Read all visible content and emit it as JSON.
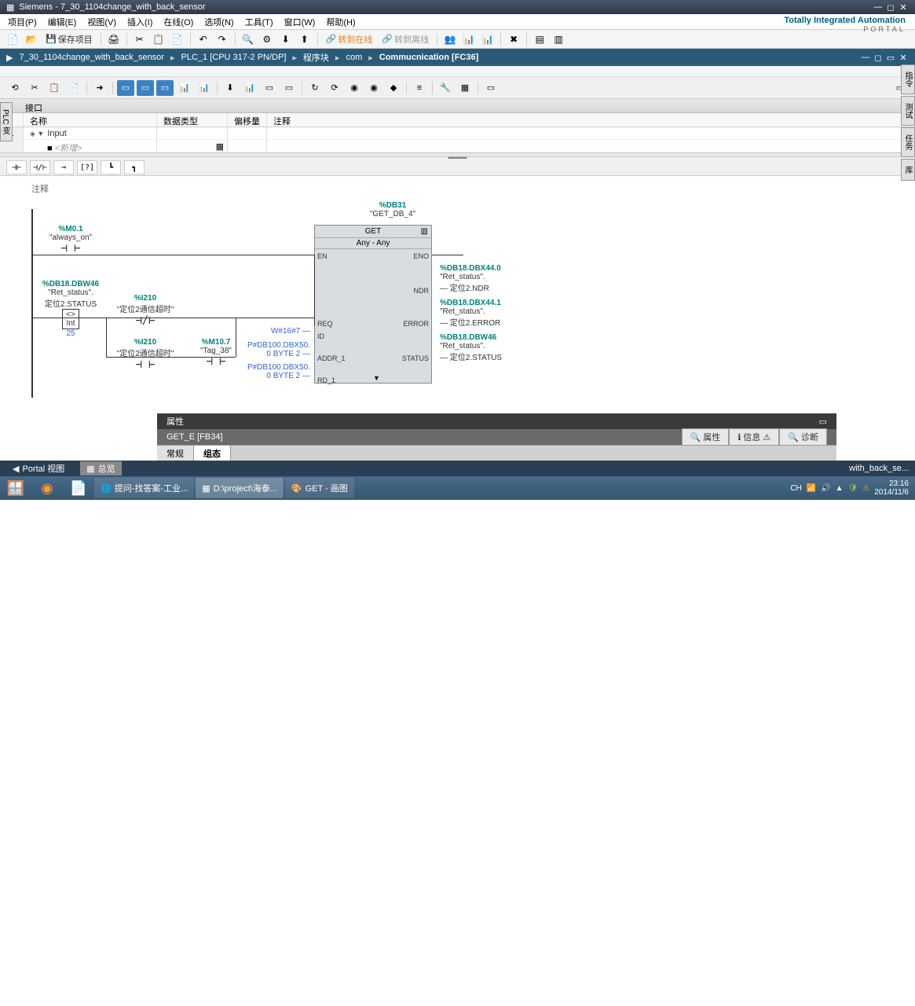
{
  "window": {
    "title": "Siemens - 7_30_1104change_with_back_sensor"
  },
  "brand": {
    "line1": "Totally Integrated Automation",
    "line2": "PORTAL"
  },
  "menu": [
    "项目(P)",
    "编辑(E)",
    "视图(V)",
    "插入(I)",
    "在线(O)",
    "选项(N)",
    "工具(T)",
    "窗口(W)",
    "帮助(H)"
  ],
  "toolbar": {
    "save": "保存项目",
    "go_online": "转到在线",
    "go_offline": "转到离线"
  },
  "breadcrumb": [
    "7_30_1104change_with_back_sensor",
    "PLC_1 [CPU 317-2 PN/DP]",
    "程序块",
    "com",
    "Commucnication [FC36]"
  ],
  "interface": {
    "title": "接口",
    "cols": [
      "",
      "名称",
      "数据类型",
      "偏移量",
      "注释"
    ],
    "rows": [
      {
        "num": "1",
        "name": "Input",
        "indent": 0,
        "expand": true
      },
      {
        "num": "",
        "name": "<新增>",
        "indent": 1,
        "placeholder": true
      }
    ]
  },
  "network": {
    "comment": "注释",
    "db_instance": {
      "addr": "%DB31",
      "name": "\"GET_DB_4\""
    },
    "contact1": {
      "addr": "%M0.1",
      "name": "\"always_on\""
    },
    "contact2": {
      "addr": "%DB18.DBW46",
      "name1": "\"Ret_status\".",
      "name2": "定位2.STATUS",
      "cmp": "<>",
      "type": "Int",
      "val": "25"
    },
    "contact3": {
      "addr": "%I210",
      "name": "\"定位2通信超时\""
    },
    "contact4": {
      "addr": "%I210",
      "name": "\"定位2通信超时\""
    },
    "contact5": {
      "addr": "%M10.7",
      "name": "\"Tag_38\""
    },
    "block": {
      "title": "GET",
      "subtitle": "Any - Any",
      "pins_left": [
        "EN",
        "REQ",
        "ID",
        "ADDR_1",
        "RD_1"
      ],
      "pins_right": [
        "ENO",
        "NDR",
        "ERROR",
        "STATUS"
      ],
      "inputs": {
        "id": "W#16#7",
        "addr1_1": "P#DB100.DBX50.",
        "addr1_2": "0 BYTE 2",
        "rd1_1": "P#DB100.DBX50.",
        "rd1_2": "0 BYTE 2"
      },
      "outputs": {
        "ndr": {
          "addr": "%DB18.DBX44.0",
          "name1": "\"Ret_status\".",
          "name2": "定位2.NDR"
        },
        "error": {
          "addr": "%DB18.DBX44.1",
          "name1": "\"Ret_status\".",
          "name2": "定位2.ERROR"
        },
        "status": {
          "addr": "%DB18.DBW46",
          "name1": "\"Ret_status\".",
          "name2": "定位2.STATUS"
        }
      }
    }
  },
  "properties": {
    "title": "属性",
    "subtitle": "GET_E [FB34]",
    "tabs": [
      "属性",
      "信息",
      "诊断"
    ],
    "sub_tabs": [
      "常规",
      "组态"
    ]
  },
  "status": {
    "portal_view": "Portal 视图",
    "overview": "总览",
    "file": "with_back_se..."
  },
  "side_tabs": [
    "指令",
    "测试",
    "任务",
    "库"
  ],
  "left_tab": "PLC 变",
  "taskbar": {
    "items": [
      {
        "label": "提问-找答案-工业..."
      },
      {
        "label": "D:\\project\\海泰..."
      },
      {
        "label": "GET - 画图"
      }
    ],
    "lang": "CH",
    "time": "23:16",
    "date": "2014/11/6"
  }
}
